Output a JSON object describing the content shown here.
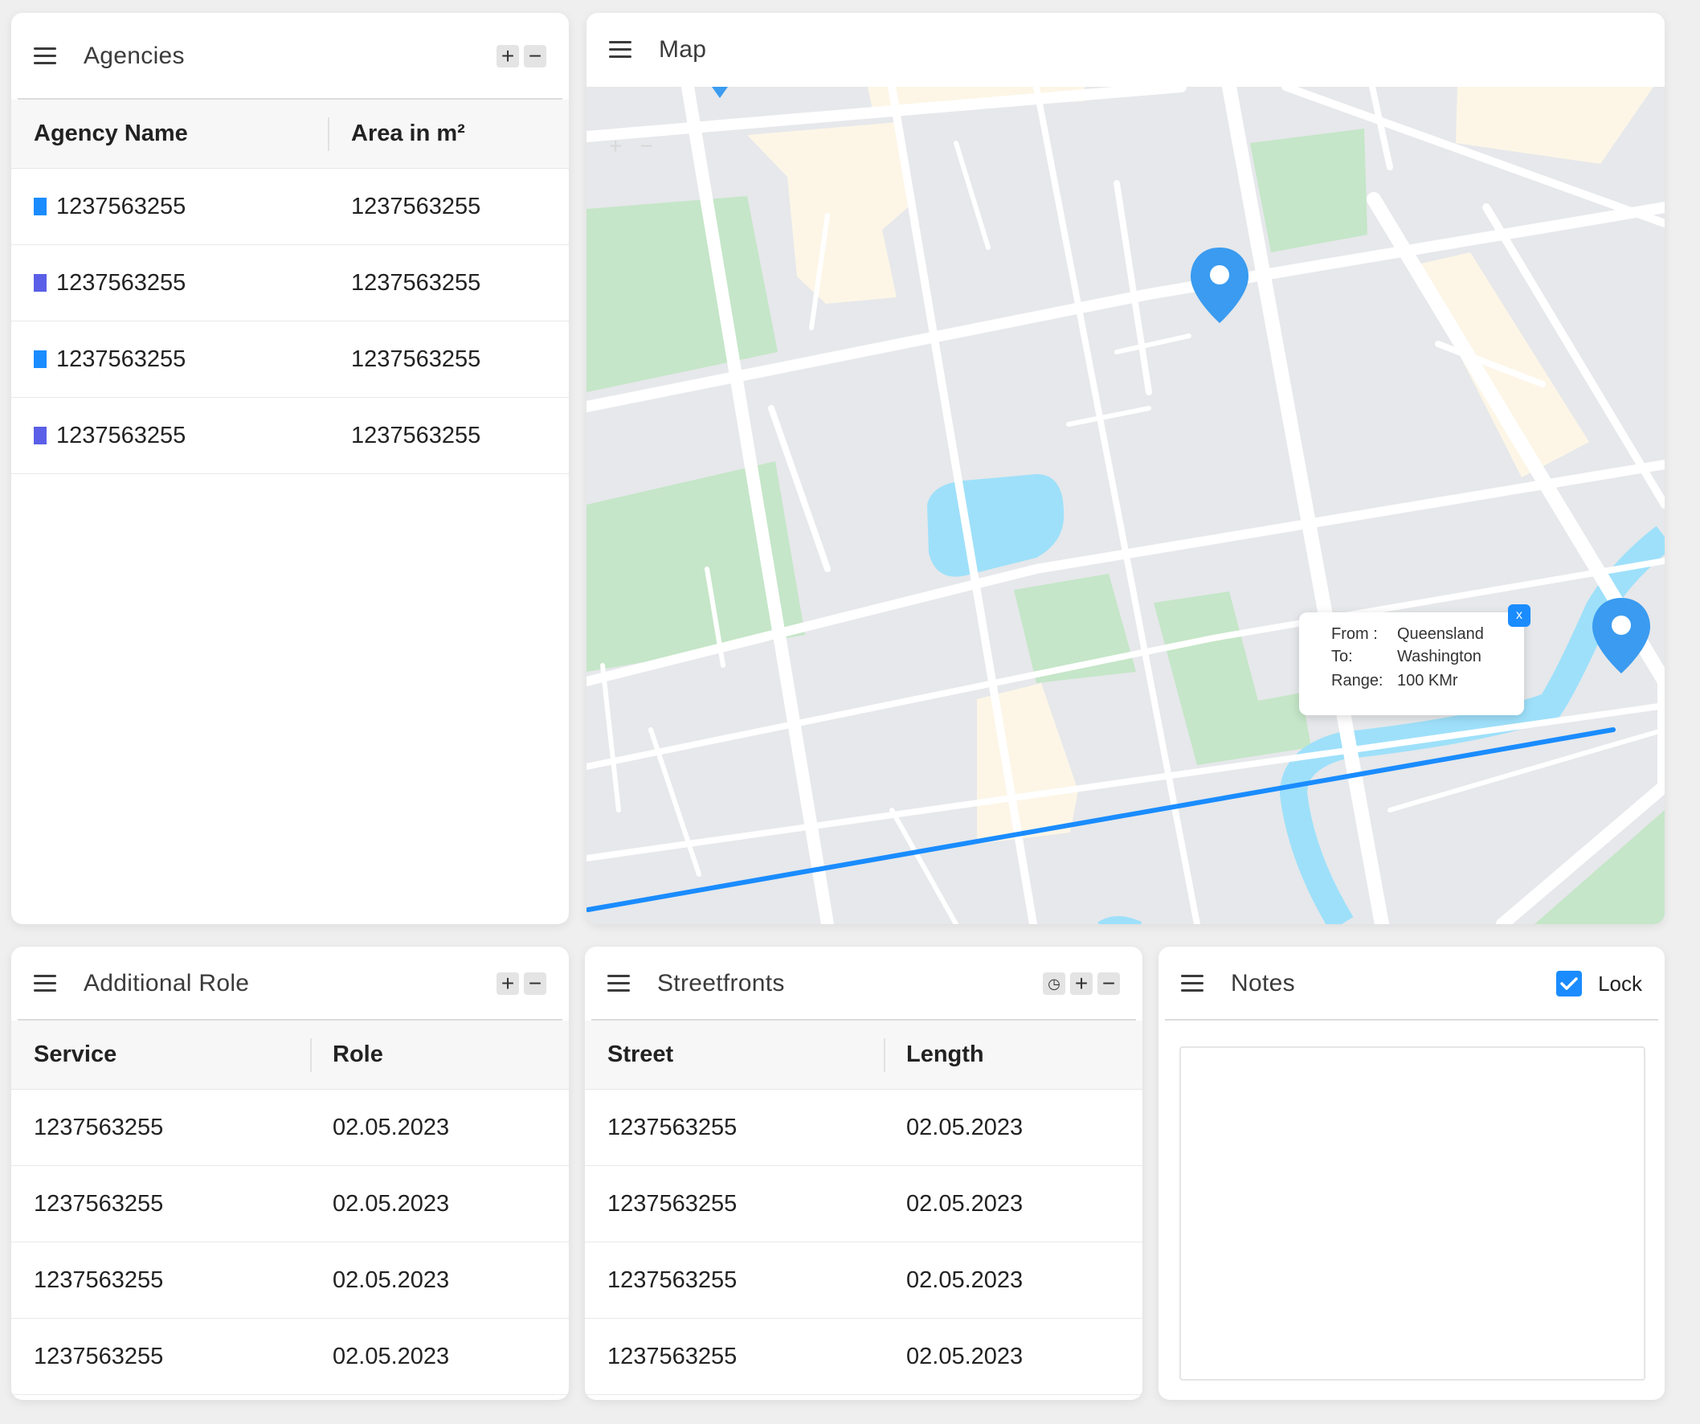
{
  "agencies": {
    "title": "Agencies",
    "columns": [
      "Agency Name",
      "Area in m²"
    ],
    "rows": [
      {
        "name": "1237563255",
        "area": "1237563255",
        "color": "#1a8cff"
      },
      {
        "name": "1237563255",
        "area": "1237563255",
        "color": "#5b5fe8"
      },
      {
        "name": "1237563255",
        "area": "1237563255",
        "color": "#1a8cff"
      },
      {
        "name": "1237563255",
        "area": "1237563255",
        "color": "#5b5fe8"
      }
    ]
  },
  "map": {
    "title": "Map",
    "popup": {
      "from_label": "From :",
      "from_value": "Queensland",
      "to_label": "To:",
      "to_value": "Washington",
      "range_label": "Range:",
      "range_value": "100 KMr",
      "close": "x"
    },
    "zoom_in": "+",
    "zoom_out": "−"
  },
  "additional_role": {
    "title": "Additional Role",
    "columns": [
      "Service",
      "Role"
    ],
    "rows": [
      {
        "service": "1237563255",
        "role": "02.05.2023"
      },
      {
        "service": "1237563255",
        "role": "02.05.2023"
      },
      {
        "service": "1237563255",
        "role": "02.05.2023"
      },
      {
        "service": "1237563255",
        "role": "02.05.2023"
      }
    ]
  },
  "streetfronts": {
    "title": "Streetfronts",
    "columns": [
      "Street",
      "Length"
    ],
    "rows": [
      {
        "street": "1237563255",
        "length": "02.05.2023"
      },
      {
        "street": "1237563255",
        "length": "02.05.2023"
      },
      {
        "street": "1237563255",
        "length": "02.05.2023"
      },
      {
        "street": "1237563255",
        "length": "02.05.2023"
      }
    ]
  },
  "notes": {
    "title": "Notes",
    "lock_label": "Lock",
    "lock_checked": true
  },
  "tools": {
    "add": "+",
    "remove": "−",
    "history": "◷"
  },
  "colors": {
    "accent": "#1a8cff",
    "swatch_alt": "#5b5fe8"
  }
}
